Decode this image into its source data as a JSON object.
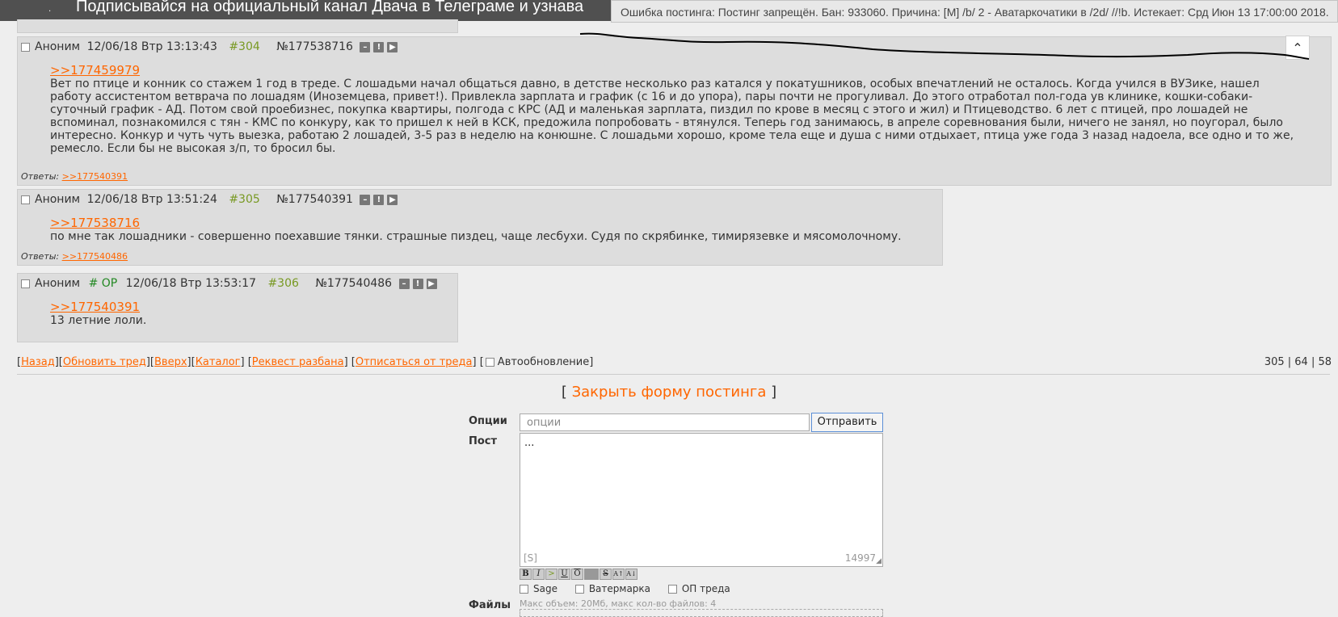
{
  "topbar": {
    "banner_text": "Подписывайся на официальный канал Двача в Телеграме и узнава",
    "dot": "."
  },
  "ban_popup": {
    "text": "Ошибка постинга: Постинг запрещён. Бан: 933060. Причина: [M] /b/ 2 - Аватаркочатики в /2d/ //!b. Истекает: Срд Июн 13 17:00:00 2018."
  },
  "posts": [
    {
      "author": "Аноним",
      "op_mark": "",
      "date": "12/06/18 Втр 13:13:43",
      "num": "#304",
      "id": "№177538716",
      "reply_to": ">>177459979",
      "text": "Вет по птице и конник со стажем 1 год в треде. С лошадьми начал общаться давно, в детстве несколько раз катался у покатушников, особых впечатлений не осталось. Когда учился в ВУЗике, нашел работу ассистентом ветврача по лошадям (Иноземцева, привет!). Привлекла зарплата и график (с 16 и до упора), пары почти не прогуливал. До этого отработал пол-года ув клинике, кошки-собаки-суточный график - АД. Потом свой проебизнес, покупка квартиры, полгода с КРС (АД и маленькая зарплата, пиздил по крове в месяц с этого и жил) и Птицеводство. 6 лет с птицей, про лошадей не вспоминал, познакомился с тян - КМС по конкуру, как то пришел к ней в КСК, предожила попробовать - втянулся. Теперь год занимаюсь, в апреле соревнования были, ничего не занял, но поугорал, было интересно. Конкур и чуть чуть выезка, работаю 2 лошадей, 3-5 раз в неделю на конюшне. С лошадьми хорошо, кроме тела еще и душа с ними отдыхает, птица уже года 3 назад надоела, все одно и то же, ремесло. Если бы не высокая з/п, то бросил бы.",
      "answers_label": "Ответы:",
      "answers_link": ">>177540391"
    },
    {
      "author": "Аноним",
      "op_mark": "",
      "date": "12/06/18 Втр 13:51:24",
      "num": "#305",
      "id": "№177540391",
      "reply_to": ">>177538716",
      "text": "по мне так лошадники - совершенно поехавшие тянки. страшные пиздец, чаще лесбухи. Судя по скрябинке, тимирязевке и мясомолочному.",
      "answers_label": "Ответы:",
      "answers_link": ">>177540486"
    },
    {
      "author": "Аноним",
      "op_mark": "# OP",
      "date": "12/06/18 Втр 13:53:17",
      "num": "#306",
      "id": "№177540486",
      "reply_to": ">>177540391",
      "text": "13 летние лоли.",
      "answers_label": "",
      "answers_link": ""
    }
  ],
  "post_icons": [
    "minus-icon",
    "report-icon",
    "play-icon"
  ],
  "nav": {
    "back": "Назад",
    "refresh": "Обновить тред",
    "top": "Вверх",
    "catalog": "Каталог",
    "unban": "Реквест разбана",
    "unsubscribe": "Отписаться от треда",
    "autoupdate": "Автообновление",
    "counts": "305 | 64 | 58"
  },
  "form": {
    "close_label": "Закрыть форму постинга",
    "options_label": "Опции",
    "options_placeholder": "опции",
    "send_label": "Отправить",
    "post_label": "Пост",
    "post_value": "...",
    "spoiler_hint": "[S]",
    "char_count": "14997",
    "markup_buttons": [
      "B",
      "I",
      ">",
      "U",
      "O",
      "",
      "S",
      "A↑",
      "A↓"
    ],
    "sage_label": "Sage",
    "watermark_label": "Ватермарка",
    "op_label": "ОП треда",
    "files_label": "Файлы",
    "files_hint": "Макс объем: 20Мб, макс кол-во файлов: 4"
  },
  "colors": {
    "link": "#ff6600",
    "post_bg": "#dddddd",
    "page_bg": "#eeeeee",
    "post_num": "#789922",
    "op": "#228822"
  }
}
